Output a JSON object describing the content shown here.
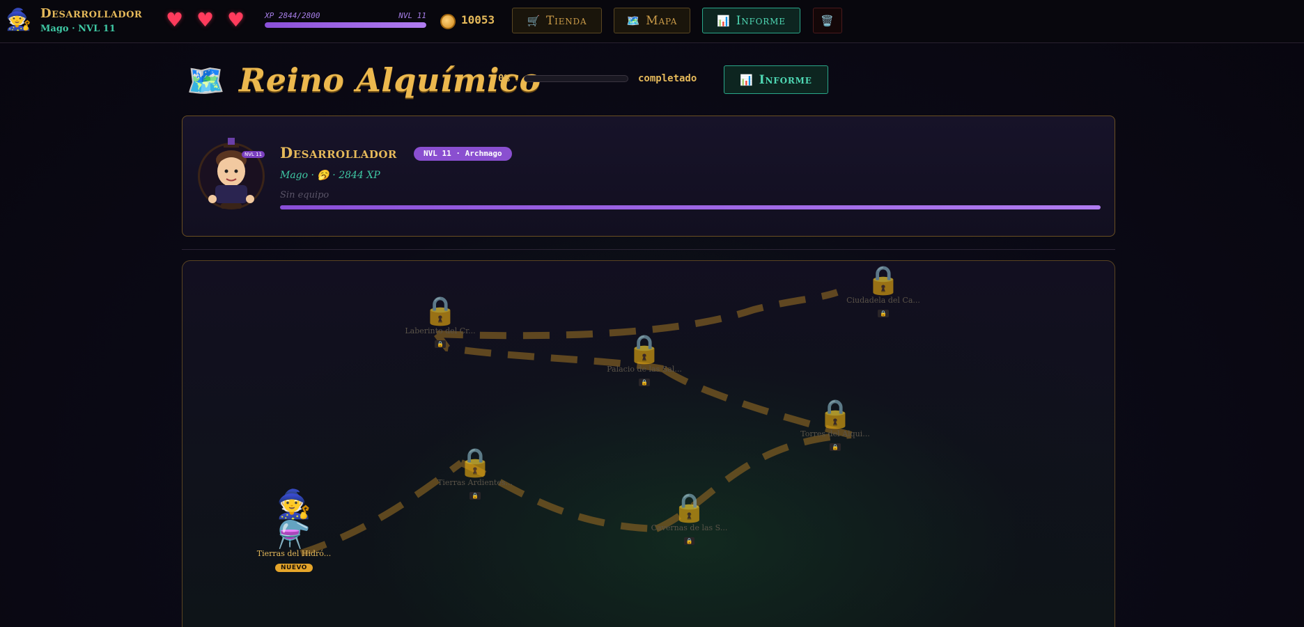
{
  "topbar": {
    "player_name": "Desarrollador",
    "player_sub": "Mago · NVL 11",
    "hearts": [
      "♥",
      "♥",
      "♥"
    ],
    "xp_text": "XP 2844/2800",
    "xp_level": "NVL 11",
    "xp_progress": 1.0,
    "coins": "10053",
    "shop_label": "Tienda",
    "map_label": "Mapa",
    "report_label": "Informe",
    "icons": {
      "shop": "🛒",
      "map": "🗺️",
      "report": "📊",
      "trash": "🗑️",
      "avatar": "🧙",
      "coin": "coin-icon"
    }
  },
  "realm": {
    "icon": "🗺️",
    "title": "Reino Alquímico",
    "percent": "0%",
    "percent_value": 0,
    "completed_label": "completado",
    "report_label": "Informe",
    "report_icon": "📊"
  },
  "character": {
    "name": "Desarrollador",
    "badge": "NVL 11 · Archmago",
    "avatar_level": "NVL 11",
    "subtitle": "Mago · 🥱 · 2844 XP",
    "equipment": "Sin equipo",
    "progress": 1.0
  },
  "world": {
    "lock_icon": "🔒",
    "lock_small": "🔒",
    "nodes": [
      {
        "label": "Laberinto del Cr...",
        "locked": true
      },
      {
        "label": "Palacio de las Sal...",
        "locked": true
      },
      {
        "label": "Ciudadela del Ca...",
        "locked": true
      },
      {
        "label": "Torres del Alqui...",
        "locked": true
      },
      {
        "label": "Tierras Ardientes...",
        "locked": true
      },
      {
        "label": "Cavernas de las S...",
        "locked": true
      },
      {
        "label": "Tierras del Hidró...",
        "locked": false,
        "badge": "NUEVO"
      }
    ],
    "player_icon": "🧙",
    "start_icon": "⚗️"
  },
  "colors": {
    "gold": "#e5b95a",
    "teal": "#3fc8a4",
    "purple": "#8a4fd8",
    "heart": "#ff3b5c"
  }
}
